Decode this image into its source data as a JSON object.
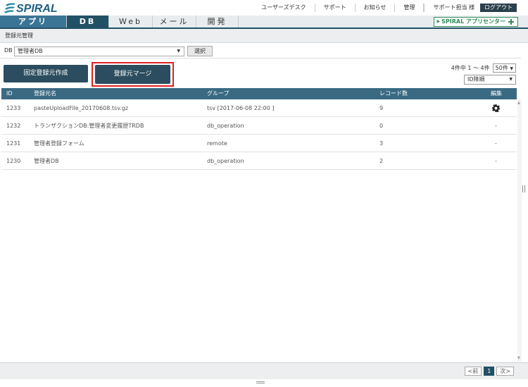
{
  "header": {
    "logo_text": "SPIRAL",
    "links": [
      "ユーザーズデスク",
      "サポート",
      "お知らせ",
      "管理"
    ],
    "user": "サポート担当 様",
    "logout": "ログアウト"
  },
  "tabs": [
    {
      "label": "アプリ"
    },
    {
      "label": "DB"
    },
    {
      "label": "Web"
    },
    {
      "label": "メール"
    },
    {
      "label": "開発"
    }
  ],
  "app_center": "SPIRAL アプリセンター",
  "breadcrumb": "登録元管理",
  "db_filter": {
    "label": "DB",
    "value": "管理者DB",
    "select_button": "選択"
  },
  "actions": {
    "fixed_create": "固定登録元作成",
    "merge": "登録元マージ"
  },
  "paging": {
    "summary": "4件中 1 ～ 4件",
    "per_page": "50件",
    "sort": "ID降順"
  },
  "table": {
    "headers": {
      "id": "ID",
      "name": "登録元名",
      "group": "グループ",
      "count": "レコード数",
      "edit": "編集"
    },
    "rows": [
      {
        "id": "1233",
        "name": "pasteUploadFile_20170608.tsv.gz",
        "group": "tsv [2017-06-08 22:00 ]",
        "count": "9",
        "edit": ""
      },
      {
        "id": "1232",
        "name": "トランザクションDB:管理者変更履歴TRDB",
        "group": "db_operation",
        "count": "0",
        "edit": "-"
      },
      {
        "id": "1231",
        "name": "管理者登録フォーム",
        "group": "remote",
        "count": "3",
        "edit": "-"
      },
      {
        "id": "1230",
        "name": "管理者DB",
        "group": "db_operation",
        "count": "2",
        "edit": "-"
      }
    ]
  },
  "pager": {
    "prev": "<前",
    "current": "1",
    "next": "次>"
  }
}
